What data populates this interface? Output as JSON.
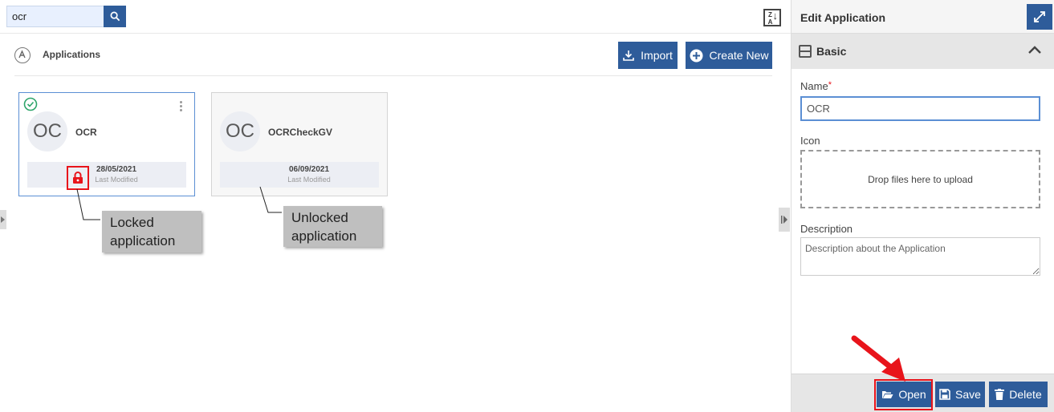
{
  "search": {
    "value": "ocr"
  },
  "main": {
    "section_title": "Applications",
    "import_label": "Import",
    "create_label": "Create New",
    "sort_label": "ZA"
  },
  "cards": [
    {
      "initials": "OC",
      "name": "OCR",
      "date": "28/05/2021",
      "sub": "Last Modified",
      "locked": true,
      "selected": true
    },
    {
      "initials": "OC",
      "name": "OCRCheckGV",
      "date": "06/09/2021",
      "sub": "Last Modified",
      "locked": false,
      "selected": false
    }
  ],
  "callouts": {
    "locked": "Locked application",
    "unlocked": "Unlocked application"
  },
  "panel": {
    "title": "Edit Application",
    "section": "Basic",
    "name_label": "Name",
    "required_mark": "*",
    "name_value": "OCR",
    "icon_label": "Icon",
    "dropzone_text": "Drop files here to upload",
    "description_label": "Description",
    "description_placeholder": "Description about the Application",
    "open_label": "Open",
    "save_label": "Save",
    "delete_label": "Delete"
  },
  "colors": {
    "primary": "#2e5c9a",
    "annotation_red": "#e8141b",
    "success_green": "#2ea56a"
  }
}
